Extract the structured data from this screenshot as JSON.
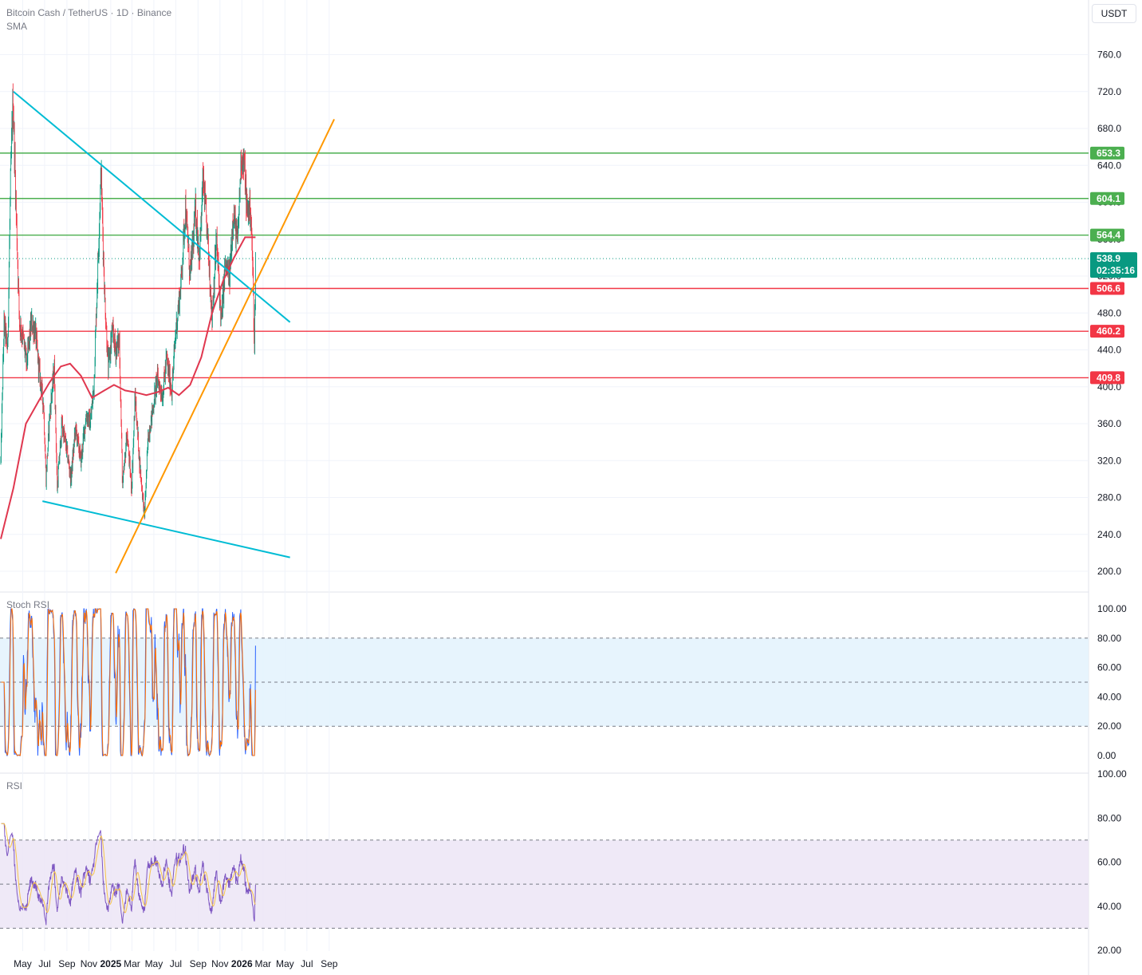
{
  "header": {
    "symbol_line": "Bitcoin Cash / TetherUS · 1D · Binance",
    "indicator": "SMA"
  },
  "currency_button": "USDT",
  "panes": {
    "stoch_title": "Stoch RSI",
    "rsi_title": "RSI"
  },
  "chart_data": [
    {
      "type": "candlestick",
      "title": "Bitcoin Cash / TetherUS · 1D · Binance",
      "series_name": "SMA",
      "x_range": [
        "2024-03-01",
        "2026-09-15"
      ],
      "ylim": [
        200,
        780
      ],
      "y_ticks": [
        "760.0",
        "720.0",
        "680.0",
        "640.0",
        "600.0",
        "560.0",
        "520.0",
        "480.0",
        "440.0",
        "400.0",
        "360.0",
        "320.0",
        "280.0",
        "240.0",
        "200.0"
      ],
      "x_ticks": [
        {
          "label": "May",
          "date": "2024-05-01"
        },
        {
          "label": "Jul",
          "date": "2024-07-01"
        },
        {
          "label": "Sep",
          "date": "2024-09-01"
        },
        {
          "label": "Nov",
          "date": "2024-11-01"
        },
        {
          "label": "2025",
          "date": "2025-01-01"
        },
        {
          "label": "Mar",
          "date": "2025-03-01"
        },
        {
          "label": "May",
          "date": "2025-05-01"
        },
        {
          "label": "Jul",
          "date": "2025-07-01"
        },
        {
          "label": "Sep",
          "date": "2025-09-01"
        },
        {
          "label": "Nov",
          "date": "2025-11-01"
        },
        {
          "label": "2026",
          "date": "2026-01-01"
        },
        {
          "label": "Mar",
          "date": "2026-03-01"
        },
        {
          "label": "May",
          "date": "2026-05-01"
        },
        {
          "label": "Jul",
          "date": "2026-07-01"
        },
        {
          "label": "Sep",
          "date": "2026-09-01"
        }
      ],
      "price_path": [
        [
          "2024-03-01",
          320
        ],
        [
          "2024-03-10",
          470
        ],
        [
          "2024-03-20",
          440
        ],
        [
          "2024-03-28",
          620
        ],
        [
          "2024-04-04",
          715
        ],
        [
          "2024-04-12",
          600
        ],
        [
          "2024-04-22",
          470
        ],
        [
          "2024-05-01",
          455
        ],
        [
          "2024-05-12",
          425
        ],
        [
          "2024-05-25",
          470
        ],
        [
          "2024-06-05",
          460
        ],
        [
          "2024-06-15",
          420
        ],
        [
          "2024-06-28",
          380
        ],
        [
          "2024-07-05",
          300
        ],
        [
          "2024-07-15",
          370
        ],
        [
          "2024-07-28",
          420
        ],
        [
          "2024-08-05",
          290
        ],
        [
          "2024-08-18",
          360
        ],
        [
          "2024-09-01",
          330
        ],
        [
          "2024-09-12",
          300
        ],
        [
          "2024-09-25",
          355
        ],
        [
          "2024-10-10",
          320
        ],
        [
          "2024-10-25",
          370
        ],
        [
          "2024-11-05",
          360
        ],
        [
          "2024-11-15",
          400
        ],
        [
          "2024-11-25",
          520
        ],
        [
          "2024-12-05",
          635
        ],
        [
          "2024-12-15",
          500
        ],
        [
          "2024-12-25",
          420
        ],
        [
          "2025-01-05",
          460
        ],
        [
          "2025-01-15",
          440
        ],
        [
          "2025-01-25",
          450
        ],
        [
          "2025-02-03",
          290
        ],
        [
          "2025-02-15",
          350
        ],
        [
          "2025-02-28",
          290
        ],
        [
          "2025-03-10",
          390
        ],
        [
          "2025-03-22",
          320
        ],
        [
          "2025-04-05",
          260
        ],
        [
          "2025-04-15",
          345
        ],
        [
          "2025-04-28",
          375
        ],
        [
          "2025-05-10",
          410
        ],
        [
          "2025-05-25",
          390
        ],
        [
          "2025-06-05",
          430
        ],
        [
          "2025-06-20",
          395
        ],
        [
          "2025-07-01",
          460
        ],
        [
          "2025-07-15",
          510
        ],
        [
          "2025-07-28",
          595
        ],
        [
          "2025-08-10",
          520
        ],
        [
          "2025-08-25",
          590
        ],
        [
          "2025-09-05",
          540
        ],
        [
          "2025-09-15",
          625
        ],
        [
          "2025-09-28",
          560
        ],
        [
          "2025-10-10",
          475
        ],
        [
          "2025-10-22",
          560
        ],
        [
          "2025-11-05",
          470
        ],
        [
          "2025-11-15",
          530
        ],
        [
          "2025-11-28",
          520
        ],
        [
          "2025-12-08",
          590
        ],
        [
          "2025-12-20",
          555
        ],
        [
          "2025-12-30",
          650
        ],
        [
          "2026-01-08",
          640
        ],
        [
          "2026-01-15",
          590
        ],
        [
          "2026-01-25",
          595
        ],
        [
          "2026-02-01",
          520
        ],
        [
          "2026-02-05",
          440
        ],
        [
          "2026-02-08",
          538.9
        ]
      ],
      "sma_path": [
        [
          "2024-03-01",
          235
        ],
        [
          "2024-04-05",
          290
        ],
        [
          "2024-05-10",
          360
        ],
        [
          "2024-06-15",
          385
        ],
        [
          "2024-07-15",
          405
        ],
        [
          "2024-08-15",
          422
        ],
        [
          "2024-09-10",
          425
        ],
        [
          "2024-10-10",
          412
        ],
        [
          "2024-11-10",
          388
        ],
        [
          "2024-12-10",
          395
        ],
        [
          "2025-01-10",
          402
        ],
        [
          "2025-02-10",
          396
        ],
        [
          "2025-03-10",
          394
        ],
        [
          "2025-04-10",
          391
        ],
        [
          "2025-05-10",
          394
        ],
        [
          "2025-06-10",
          399
        ],
        [
          "2025-07-10",
          391
        ],
        [
          "2025-08-10",
          402
        ],
        [
          "2025-09-10",
          432
        ],
        [
          "2025-10-10",
          480
        ],
        [
          "2025-11-10",
          515
        ],
        [
          "2025-12-10",
          540
        ],
        [
          "2026-01-10",
          562
        ],
        [
          "2026-02-08",
          562
        ]
      ],
      "trendlines": [
        {
          "color": "#00bcd4",
          "from": [
            "2024-04-05",
            720
          ],
          "to": [
            "2026-05-15",
            470
          ]
        },
        {
          "color": "#00bcd4",
          "from": [
            "2024-06-25",
            276
          ],
          "to": [
            "2026-05-15",
            215
          ]
        },
        {
          "color": "#ff9800",
          "from": [
            "2025-01-15",
            198
          ],
          "to": [
            "2026-09-15",
            690
          ]
        }
      ],
      "horizontal_levels": [
        {
          "value": "653.3",
          "color": "#4caf50"
        },
        {
          "value": "604.1",
          "color": "#4caf50"
        },
        {
          "value": "564.4",
          "color": "#4caf50"
        },
        {
          "value": "506.6",
          "color": "#f23645"
        },
        {
          "value": "460.2",
          "color": "#f23645"
        },
        {
          "value": "409.8",
          "color": "#f23645"
        }
      ],
      "last_price": {
        "value": "538.9",
        "countdown": "02:35:16",
        "color": "#089981"
      }
    },
    {
      "type": "line",
      "title": "Stoch RSI",
      "ylim": [
        0,
        100
      ],
      "y_ticks": [
        "100.00",
        "80.00",
        "60.00",
        "40.00",
        "20.00",
        "0.00"
      ],
      "band": [
        20,
        80
      ],
      "series": [
        {
          "color": "#2962ff"
        },
        {
          "color": "#ff6d00"
        }
      ]
    },
    {
      "type": "line",
      "title": "RSI",
      "ylim": [
        20,
        100
      ],
      "y_ticks": [
        "100.00",
        "80.00",
        "60.00",
        "40.00",
        "20.00"
      ],
      "band": [
        30,
        70
      ],
      "series": [
        {
          "color": "#7e57c2"
        },
        {
          "color": "#f7c548"
        }
      ]
    }
  ]
}
